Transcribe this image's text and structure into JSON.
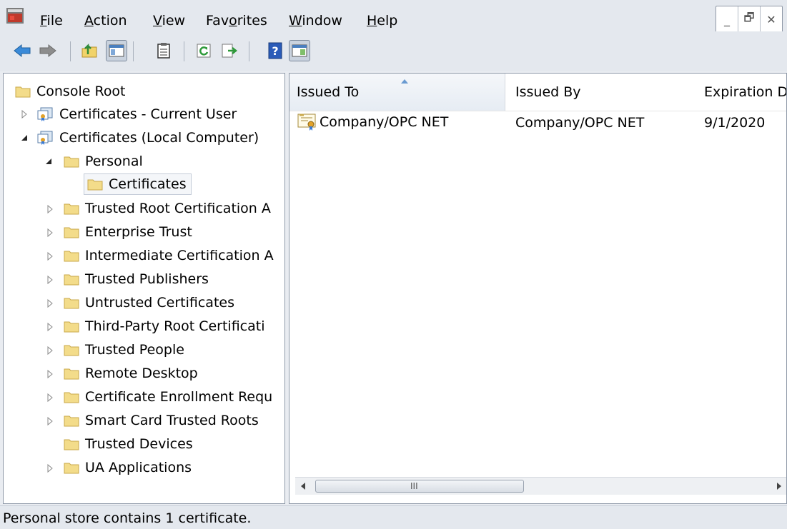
{
  "menu": {
    "items": [
      {
        "label": "File",
        "accel": "F",
        "rest": "ile"
      },
      {
        "label": "Action",
        "accel": "A",
        "rest": "ction"
      },
      {
        "label": "View",
        "accel": "V",
        "rest": "iew"
      },
      {
        "label": "Favorites",
        "pre": "Fav",
        "accel": "o",
        "rest": "rites"
      },
      {
        "label": "Window",
        "accel": "W",
        "rest": "indow"
      },
      {
        "label": "Help",
        "accel": "H",
        "rest": "elp"
      }
    ],
    "window_controls": [
      "_",
      "🗗",
      "✕"
    ]
  },
  "toolbar": {
    "buttons": [
      "back-arrow-icon",
      "forward-arrow-icon",
      "up-one-level-icon",
      "show-hide-console-tree-icon",
      "properties-icon",
      "refresh-icon",
      "export-list-icon",
      "help-icon",
      "show-hide-action-pane-icon"
    ]
  },
  "tree": {
    "root": "Console Root",
    "nodes": [
      "Certificates - Current User",
      "Certificates (Local Computer)",
      "Personal",
      "Certificates",
      "Trusted Root Certification A",
      "Enterprise Trust",
      "Intermediate Certification A",
      "Trusted Publishers",
      "Untrusted Certificates",
      "Third-Party Root Certificati",
      "Trusted People",
      "Remote Desktop",
      "Certificate Enrollment Requ",
      "Smart Card Trusted Roots",
      "Trusted Devices",
      "UA Applications"
    ]
  },
  "list": {
    "columns": [
      "Issued To",
      "Issued By",
      "Expiration D"
    ],
    "rows": [
      {
        "issued_to": "Company/OPC NET",
        "issued_by": "Company/OPC NET",
        "expiration": "9/1/2020"
      }
    ],
    "scroll_grip": "III"
  },
  "status": {
    "text": "Personal store contains 1 certificate."
  },
  "colors": {
    "chrome": "#e4e8ee",
    "folder": "#f3dc8a",
    "folder_border": "#c9a84a"
  }
}
